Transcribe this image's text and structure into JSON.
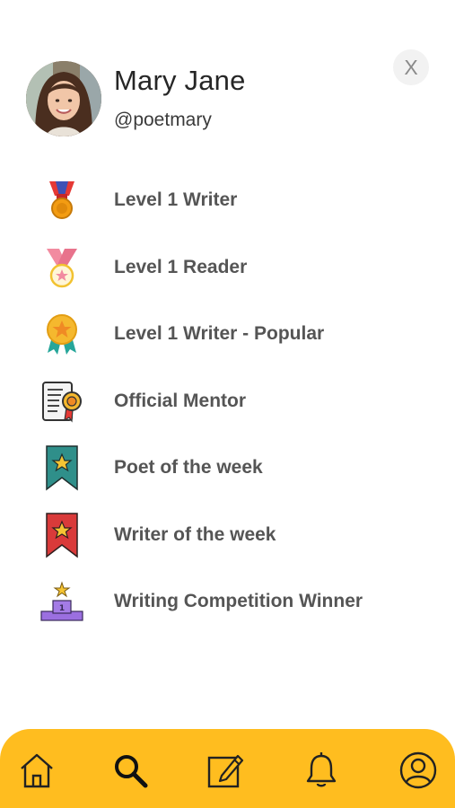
{
  "profile": {
    "name": "Mary Jane",
    "handle": "@poetmary"
  },
  "close_label": "X",
  "badges": [
    {
      "label": "Level 1 Writer",
      "icon": "red-ribbon-medal-icon"
    },
    {
      "label": "Level 1 Reader",
      "icon": "pink-ribbon-medal-icon"
    },
    {
      "label": "Level 1 Writer - Popular",
      "icon": "gold-star-rosette-icon"
    },
    {
      "label": "Official Mentor",
      "icon": "certificate-icon"
    },
    {
      "label": "Poet of the week",
      "icon": "teal-star-bookmark-icon"
    },
    {
      "label": "Writer of the week",
      "icon": "red-star-bookmark-icon"
    },
    {
      "label": "Writing Competition Winner",
      "icon": "podium-icon"
    }
  ],
  "nav": {
    "items": [
      "home-icon",
      "search-icon",
      "compose-icon",
      "bell-icon",
      "profile-icon"
    ],
    "background_color": "#ffbd1f"
  },
  "colors": {
    "accent": "#ffbd1f",
    "badge_text": "#555555"
  }
}
